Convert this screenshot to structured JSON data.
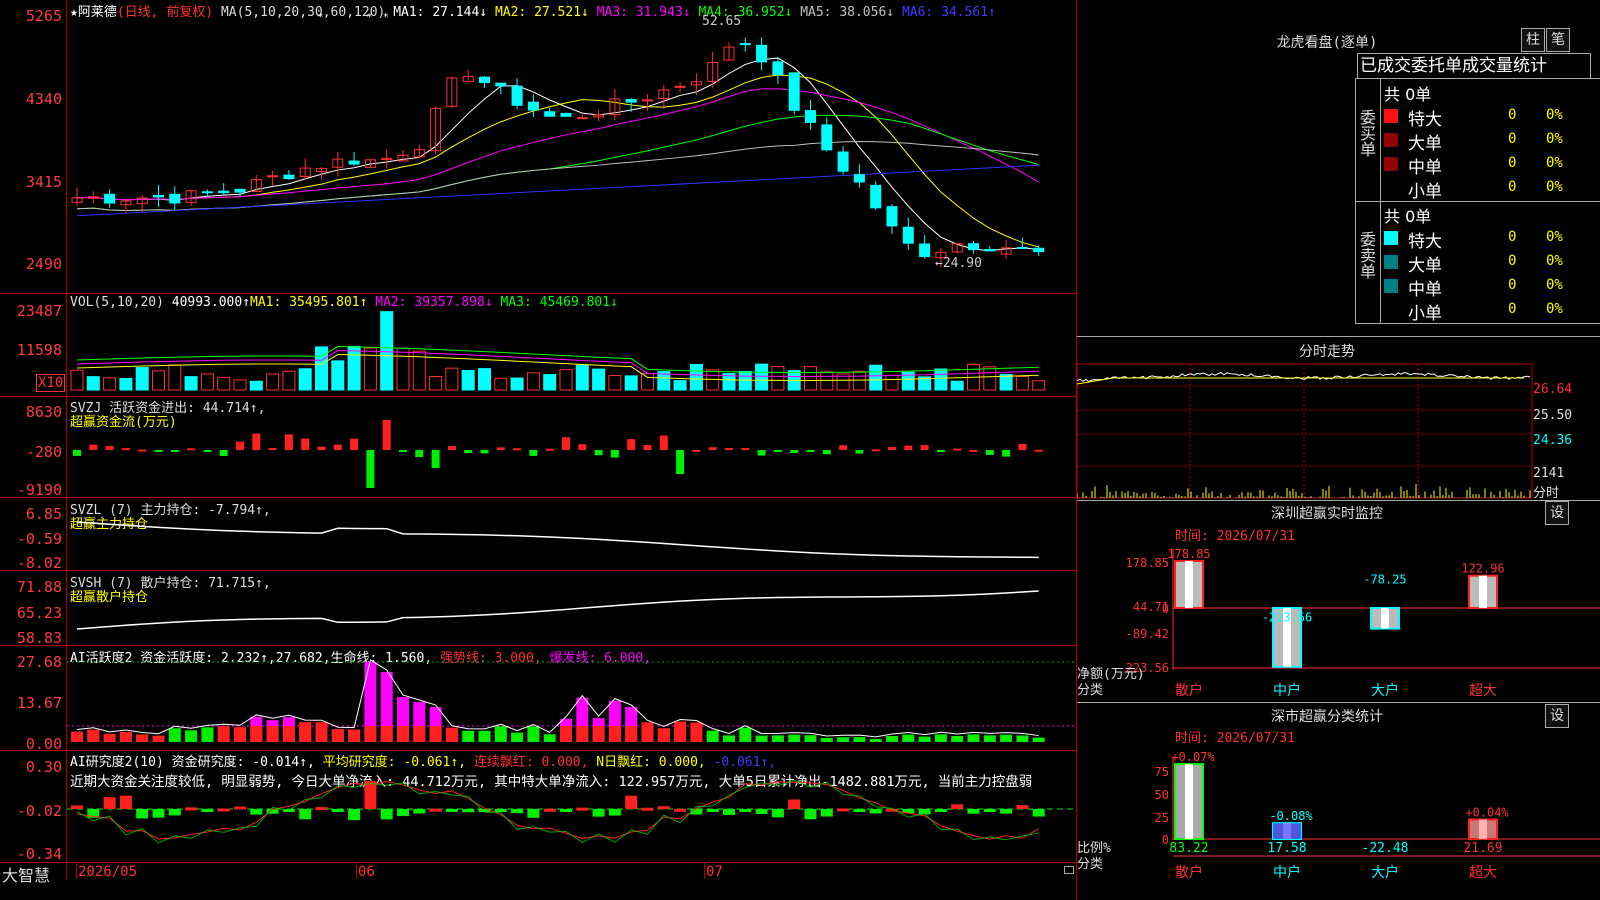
{
  "app": {
    "name": "大智慧"
  },
  "stock": {
    "name": "阿莱德",
    "period_label": "(日线, 前复权)"
  },
  "main_chart": {
    "ma_label": "MA(5,10,20,30,60,120)",
    "ma1": "MA1: 27.144↓",
    "ma2": "MA2: 27.521↓",
    "ma3": "MA3: 31.943↓",
    "ma4": "MA4: 36.952↓",
    "ma5": "MA5: 38.056↓",
    "ma6": "MA6: 34.561↑",
    "y_ticks": [
      "5265",
      "4340",
      "3415",
      "2490"
    ],
    "high_label": "52.65",
    "low_label": "←24.90",
    "colors": {
      "up": "#ff3030",
      "down": "#00ffff",
      "ma1": "#ffffff",
      "ma2": "#ffff00",
      "ma3": "#ff00ff",
      "ma4": "#00ff00",
      "ma5": "#c0c0c0",
      "ma6": "#3030ff"
    }
  },
  "vol_panel": {
    "label": "VOL(5,10,20)",
    "value": "40993.000↑",
    "ma1": "MA1: 35495.801↑",
    "ma2": "MA2: 39357.898↓",
    "ma3": "MA3: 45469.801↓",
    "y_ticks": [
      "23487",
      "11598"
    ],
    "unit": "X10"
  },
  "svzj": {
    "label": "SVZJ  活跃资金进出: 44.714↑,",
    "sub": "超赢资金流(万元)",
    "y_ticks": [
      "8630",
      "-280",
      "-9190"
    ]
  },
  "svzl": {
    "label": "SVZL (7) 主力持仓: -7.794↑,",
    "sub": "超赢主力持仓",
    "y_ticks": [
      "6.85",
      "-0.59",
      "-8.02"
    ]
  },
  "svsh": {
    "label": "SVSH (7) 散户持仓: 71.715↑,",
    "sub": "超赢散户持仓",
    "y_ticks": [
      "71.88",
      "65.23",
      "58.83"
    ]
  },
  "ai_active": {
    "label": "AI活跃度2 资金活跃度: 2.232↑,27.682,生命线: 1.560,",
    "strong": "强势线: 3.000,",
    "burst": "爆发线: 6.000,",
    "y_ticks": [
      "27.68",
      "13.67",
      "0.00"
    ]
  },
  "ai_research": {
    "label": "AI研究度2(10) 资金研究度: -0.014↑,",
    "avg": "平均研究度: -0.061↑,",
    "cont": "连续飘红: 0.000,",
    "nday": "N日飘红: 0.000,",
    "nval": "-0.061↑,",
    "comment": "近期大资金关注度较低, 明显弱势, 今日大单净流入: 44.712万元, 其中特大单净流入: 122.957万元, 大单5日累计净出-1482.881万元, 当前主力控盘弱",
    "y_ticks": [
      "0.30",
      "-0.02",
      "-0.34"
    ]
  },
  "x_axis": {
    "labels": [
      "2026/05",
      "06",
      "07"
    ]
  },
  "dragon": {
    "title": "龙虎看盘(逐单)",
    "btn_bar": "柱",
    "btn_detail": "笔",
    "tab": "已成交委托单成交量统计",
    "buy": {
      "side": "委买单",
      "total": "共 0单",
      "rows": [
        {
          "name": "特大",
          "qty": "0",
          "pct": "0%"
        },
        {
          "name": "大单",
          "qty": "0",
          "pct": "0%"
        },
        {
          "name": "中单",
          "qty": "0",
          "pct": "0%"
        },
        {
          "name": "小单",
          "qty": "0",
          "pct": "0%"
        }
      ]
    },
    "sell": {
      "side": "委卖单",
      "total": "共 0单",
      "rows": [
        {
          "name": "特大",
          "qty": "0",
          "pct": "0%"
        },
        {
          "name": "大单",
          "qty": "0",
          "pct": "0%"
        },
        {
          "name": "中单",
          "qty": "0",
          "pct": "0%"
        },
        {
          "name": "小单",
          "qty": "0",
          "pct": "0%"
        }
      ]
    }
  },
  "intraday": {
    "title": "分时走势",
    "y_ticks": [
      "26.64",
      "25.50",
      "24.36",
      "2141"
    ],
    "unit": "分时"
  },
  "sz_monitor": {
    "title": "深圳超赢实时监控",
    "btn": "设",
    "time": "时间: 2026/07/31",
    "y_ticks": [
      "178.85",
      "44.71",
      "0",
      "-89.42",
      "-223.56"
    ],
    "ylabel": "净额(万元)",
    "xlabel": "分类",
    "categories": [
      "散户",
      "中户",
      "大户",
      "超大"
    ],
    "values": [
      178.85,
      -223.56,
      -78.25,
      122.96
    ],
    "value_labels": [
      "178.85",
      "-223.56",
      "-78.25",
      "122.96"
    ]
  },
  "sz_class": {
    "title": "深市超赢分类统计",
    "btn": "设",
    "time": "时间: 2026/07/31",
    "y_ticks": [
      "75",
      "50",
      "25",
      "0"
    ],
    "ylabel": "比例%",
    "xlabel": "分类",
    "categories": [
      "散户",
      "中户",
      "大户",
      "超大"
    ],
    "top_labels": [
      "+0.07%",
      "-0.08%",
      "",
      "+0.04%"
    ],
    "values": [
      83.22,
      17.58,
      -22.48,
      21.69
    ],
    "value_labels": [
      "83.22",
      "17.58",
      "-22.48",
      "21.69"
    ]
  }
}
